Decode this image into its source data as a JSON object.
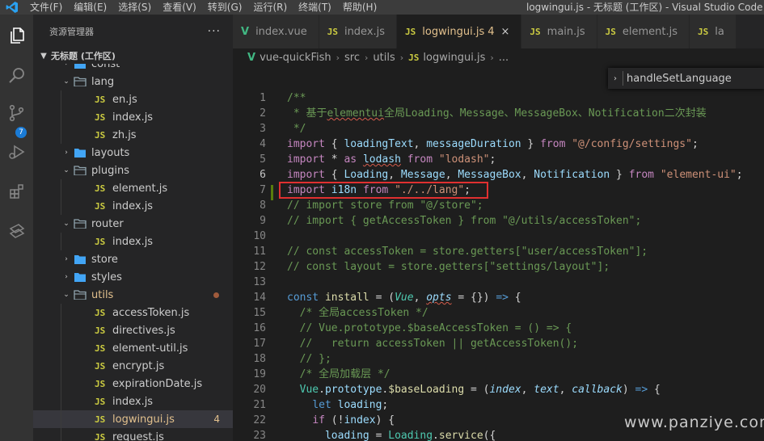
{
  "titlebar": {
    "menus": [
      "文件(F)",
      "编辑(E)",
      "选择(S)",
      "查看(V)",
      "转到(G)",
      "运行(R)",
      "终端(T)",
      "帮助(H)"
    ],
    "window_title": "logwingui.js - 无标题 (工作区) - Visual Studio Code [管理"
  },
  "activitybar": {
    "scm_badge": "7"
  },
  "sidebar": {
    "header": "资源管理器",
    "more": "···",
    "workspace": "无标题 (工作区)",
    "rows": [
      {
        "label": "const",
        "type": "folder",
        "depth": 1
      },
      {
        "label": "lang",
        "type": "folder-open",
        "depth": 1
      },
      {
        "label": "en.js",
        "type": "js",
        "depth": 2
      },
      {
        "label": "index.js",
        "type": "js",
        "depth": 2
      },
      {
        "label": "zh.js",
        "type": "js",
        "depth": 2
      },
      {
        "label": "layouts",
        "type": "folder",
        "depth": 1
      },
      {
        "label": "plugins",
        "type": "folder-open",
        "depth": 1
      },
      {
        "label": "element.js",
        "type": "js",
        "depth": 2
      },
      {
        "label": "index.js",
        "type": "js",
        "depth": 2
      },
      {
        "label": "router",
        "type": "folder-open",
        "depth": 1
      },
      {
        "label": "index.js",
        "type": "js",
        "depth": 2
      },
      {
        "label": "store",
        "type": "folder",
        "depth": 1
      },
      {
        "label": "styles",
        "type": "folder",
        "depth": 1
      },
      {
        "label": "utils",
        "type": "folder-open",
        "depth": 1,
        "modified": true
      },
      {
        "label": "accessToken.js",
        "type": "js",
        "depth": 2
      },
      {
        "label": "directives.js",
        "type": "js",
        "depth": 2
      },
      {
        "label": "element-util.js",
        "type": "js",
        "depth": 2
      },
      {
        "label": "encrypt.js",
        "type": "js",
        "depth": 2
      },
      {
        "label": "expirationDate.js",
        "type": "js",
        "depth": 2
      },
      {
        "label": "index.js",
        "type": "js",
        "depth": 2
      },
      {
        "label": "logwingui.js",
        "type": "js",
        "depth": 2,
        "modified": true,
        "selected": true,
        "problems": "4"
      },
      {
        "label": "request.js",
        "type": "js",
        "depth": 2
      }
    ]
  },
  "tabs": [
    {
      "label": "index.vue",
      "icon": "vue",
      "active": false
    },
    {
      "label": "index.js",
      "icon": "JS",
      "active": false
    },
    {
      "label": "logwingui.js",
      "icon": "JS",
      "active": true,
      "count": "4",
      "close": "×"
    },
    {
      "label": "main.js",
      "icon": "JS",
      "active": false
    },
    {
      "label": "element.js",
      "icon": "JS",
      "active": false
    },
    {
      "label": "la",
      "icon": "JS",
      "active": false
    }
  ],
  "breadcrumb": {
    "items": [
      "vue-quickFish",
      "src",
      "utils",
      "logwingui.js",
      "..."
    ]
  },
  "find_widget": {
    "value": "handleSetLanguage"
  },
  "editor": {
    "current_line": "6",
    "lines": [
      {
        "n": "1",
        "html": "<span class='c'>/**</span>"
      },
      {
        "n": "2",
        "html": "<span class='c'> * 基于<span class='sq'>elementui</span>全局Loading、Message、MessageBox、Notification二次封装</span>"
      },
      {
        "n": "3",
        "html": "<span class='c'> */</span>"
      },
      {
        "n": "4",
        "html": "<span class='kc'>import</span><span class='p'> { </span><span class='v'>loadingText</span><span class='p'>, </span><span class='v'>messageDuration</span><span class='p'> } </span><span class='kc'>from</span><span class='p'> </span><span class='s'>\"@/config/settings\"</span><span class='p'>;</span>"
      },
      {
        "n": "5",
        "html": "<span class='kc'>import</span><span class='p'> * </span><span class='kc'>as</span><span class='p'> </span><span class='v sq'>lodash</span><span class='p'> </span><span class='kc'>from</span><span class='p'> </span><span class='s'>\"lodash\"</span><span class='p'>;</span>"
      },
      {
        "n": "6",
        "html": "<span class='kc'>import</span><span class='p'> { </span><span class='v'>Loading</span><span class='p'>, </span><span class='v'>Message</span><span class='p'>, </span><span class='v'>MessageBox</span><span class='p'>, </span><span class='v'>Notification</span><span class='p'> } </span><span class='kc'>from</span><span class='p'> </span><span class='s'>\"element-ui\"</span><span class='p'>;</span>"
      },
      {
        "n": "7",
        "html": "<span class='kc'>import</span><span class='p'> </span><span class='v'>i18n</span><span class='p'> </span><span class='kc'>from</span><span class='p'> </span><span class='s'>\"./../lang\"</span><span class='p'>;</span>"
      },
      {
        "n": "8",
        "html": "<span class='c'>// import store from \"@/store\";</span>"
      },
      {
        "n": "9",
        "html": "<span class='c'>// import { getAccessToken } from \"@/utils/accessToken\";</span>"
      },
      {
        "n": "10",
        "html": ""
      },
      {
        "n": "11",
        "html": "<span class='c'>// const accessToken = store.getters[\"user/accessToken\"];</span>"
      },
      {
        "n": "12",
        "html": "<span class='c'>// const layout = store.getters[\"settings/layout\"];</span>"
      },
      {
        "n": "13",
        "html": ""
      },
      {
        "n": "14",
        "html": "<span class='k'>const</span><span class='p'> </span><span class='f'>install</span><span class='p'> = (</span><span class='cls'>Vue</span><span class='p'>, </span><span class='pr sq'>opts</span><span class='p'> = {}) </span><span class='k'>=&gt;</span><span class='p'> {</span>"
      },
      {
        "n": "15",
        "html": "<span class='c'>  /* 全局accessToken */</span>"
      },
      {
        "n": "16",
        "html": "<span class='c'>  // Vue.prototype.$baseAccessToken = () =&gt; {</span>"
      },
      {
        "n": "17",
        "html": "<span class='c'>  //   return accessToken || getAccessToken();</span>"
      },
      {
        "n": "18",
        "html": "<span class='c'>  // };</span>"
      },
      {
        "n": "19",
        "html": "<span class='c'>  /* 全局加载层 */</span>"
      },
      {
        "n": "20",
        "html": "<span class='p'>  </span><span class='t'>Vue</span><span class='p'>.</span><span class='v'>prototype</span><span class='p'>.</span><span class='f'>$baseLoading</span><span class='p'> = (</span><span class='pr'>index</span><span class='p'>, </span><span class='pr'>text</span><span class='p'>, </span><span class='pr'>callback</span><span class='p'>) </span><span class='k'>=&gt;</span><span class='p'> {</span>"
      },
      {
        "n": "21",
        "html": "<span class='p'>    </span><span class='k'>let</span><span class='p'> </span><span class='v'>loading</span><span class='p'>;</span>"
      },
      {
        "n": "22",
        "html": "<span class='p'>    </span><span class='kc'>if</span><span class='p'> (!</span><span class='v'>index</span><span class='p'>) {</span>"
      },
      {
        "n": "23",
        "html": "<span class='p'>      </span><span class='v'>loading</span><span class='p'> = </span><span class='t'>Loading</span><span class='p'>.</span><span class='f'>service</span><span class='p'>({</span>"
      }
    ]
  },
  "watermark": "www.panziye.com"
}
